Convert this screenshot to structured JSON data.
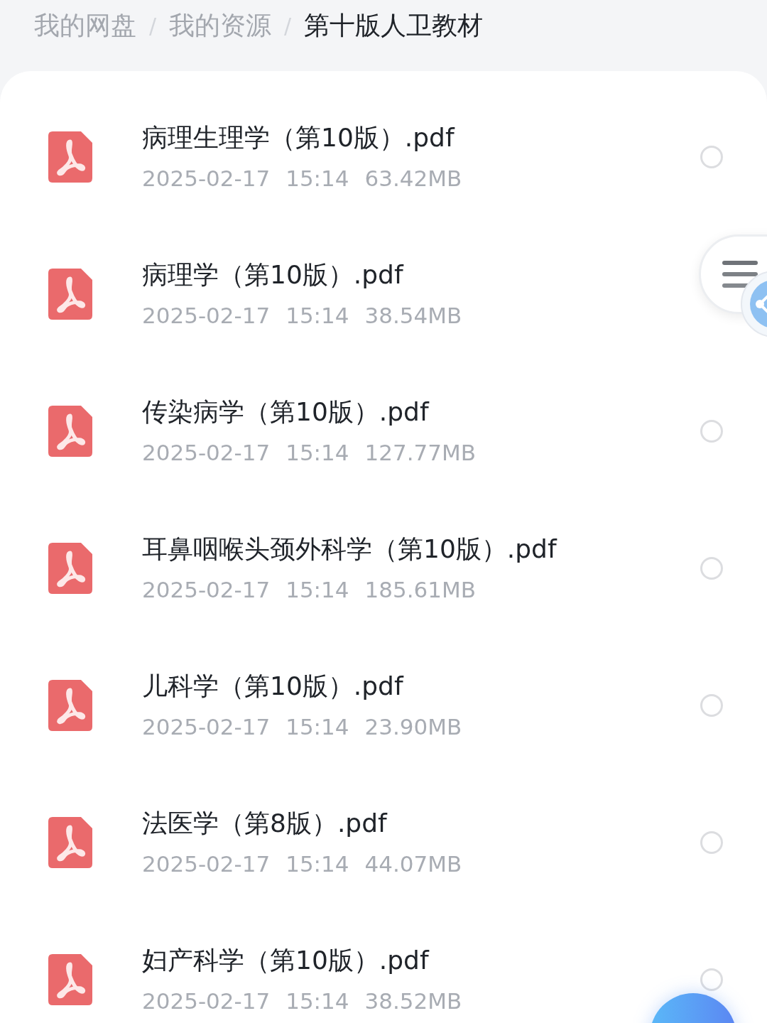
{
  "breadcrumb": [
    {
      "kind": "crumb",
      "label": "我的网盘",
      "selected": false
    },
    {
      "kind": "separator",
      "label": "/"
    },
    {
      "kind": "crumb",
      "label": "我的资源",
      "selected": false
    },
    {
      "kind": "separator",
      "label": "/"
    },
    {
      "kind": "crumb",
      "label": "第十版人卫教材",
      "selected": true
    }
  ],
  "files": [
    {
      "name": "病理生理学（第10版）.pdf",
      "date": "2025-02-17",
      "time": "15:14",
      "size": "63.42MB",
      "selected": false
    },
    {
      "name": "病理学（第10版）.pdf",
      "date": "2025-02-17",
      "time": "15:14",
      "size": "38.54MB"
    },
    {
      "name": "传染病学（第10版）.pdf",
      "date": "2025-02-17",
      "time": "15:14",
      "size": "127.77MB",
      "selected": false
    },
    {
      "name": "耳鼻咽喉头颈外科学（第10版）.pdf",
      "date": "2025-02-17",
      "time": "15:14",
      "size": "185.61MB",
      "selected": false
    },
    {
      "name": "儿科学（第10版）.pdf",
      "date": "2025-02-17",
      "time": "15:14",
      "size": "23.90MB",
      "selected": false
    },
    {
      "name": "法医学（第8版）.pdf",
      "date": "2025-02-17",
      "time": "15:14",
      "size": "44.07MB",
      "selected": false
    },
    {
      "name": "妇产科学（第10版）.pdf",
      "date": "2025-02-17",
      "time": "15:14",
      "size": "38.52MB",
      "selected": false
    }
  ]
}
